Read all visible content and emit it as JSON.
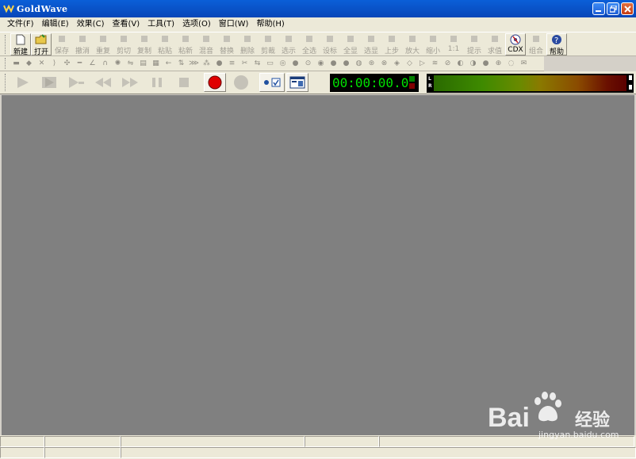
{
  "window": {
    "title": "GoldWave"
  },
  "menu": [
    "文件(F)",
    "编辑(E)",
    "效果(C)",
    "查看(V)",
    "工具(T)",
    "选项(O)",
    "窗口(W)",
    "帮助(H)"
  ],
  "toolbar": [
    {
      "label": "新建",
      "icon": "new-file-icon",
      "enabled": true
    },
    {
      "label": "打开",
      "icon": "open-folder-icon",
      "enabled": true
    },
    {
      "label": "保存",
      "icon": "save-icon",
      "enabled": false
    },
    {
      "label": "撤消",
      "icon": "undo-icon",
      "enabled": false
    },
    {
      "label": "重复",
      "icon": "redo-icon",
      "enabled": false
    },
    {
      "label": "剪切",
      "icon": "cut-icon",
      "enabled": false
    },
    {
      "label": "复制",
      "icon": "copy-icon",
      "enabled": false
    },
    {
      "label": "粘贴",
      "icon": "paste-icon",
      "enabled": false
    },
    {
      "label": "粘新",
      "icon": "paste-new-icon",
      "enabled": false
    },
    {
      "label": "混音",
      "icon": "mix-icon",
      "enabled": false
    },
    {
      "label": "替换",
      "icon": "replace-icon",
      "enabled": false
    },
    {
      "label": "删除",
      "icon": "delete-icon",
      "enabled": false
    },
    {
      "label": "剪裁",
      "icon": "trim-icon",
      "enabled": false
    },
    {
      "label": "选示",
      "icon": "select-view-icon",
      "enabled": false
    },
    {
      "label": "全选",
      "icon": "select-all-icon",
      "enabled": false
    },
    {
      "label": "设标",
      "icon": "set-marker-icon",
      "enabled": false
    },
    {
      "label": "全显",
      "icon": "show-all-icon",
      "enabled": false
    },
    {
      "label": "选显",
      "icon": "show-selection-icon",
      "enabled": false
    },
    {
      "label": "上步",
      "icon": "previous-icon",
      "enabled": false
    },
    {
      "label": "放大",
      "icon": "zoom-in-icon",
      "enabled": false
    },
    {
      "label": "缩小",
      "icon": "zoom-out-icon",
      "enabled": false
    },
    {
      "label": "1:1",
      "icon": "zoom-actual-icon",
      "enabled": false
    },
    {
      "label": "提示",
      "icon": "cue-icon",
      "enabled": false
    },
    {
      "label": "求值",
      "icon": "evaluate-icon",
      "enabled": false
    },
    {
      "label": "CDX",
      "icon": "cd-icon",
      "enabled": true
    },
    {
      "label": "组合",
      "icon": "combine-icon",
      "enabled": false
    },
    {
      "label": "帮助",
      "icon": "help-icon",
      "enabled": true
    }
  ],
  "effects_icon_count": 41,
  "transport": {
    "time": "00:00:00.0",
    "meter_channels": [
      "L",
      "R"
    ]
  },
  "watermark": {
    "brand": "Bai",
    "brand_cn": "经验",
    "url": "jingyan.baidu.com"
  },
  "colors": {
    "titlebar": "#0846b8",
    "workspace": "#808080",
    "time_text": "#00e000",
    "record_red": "#e00000"
  }
}
